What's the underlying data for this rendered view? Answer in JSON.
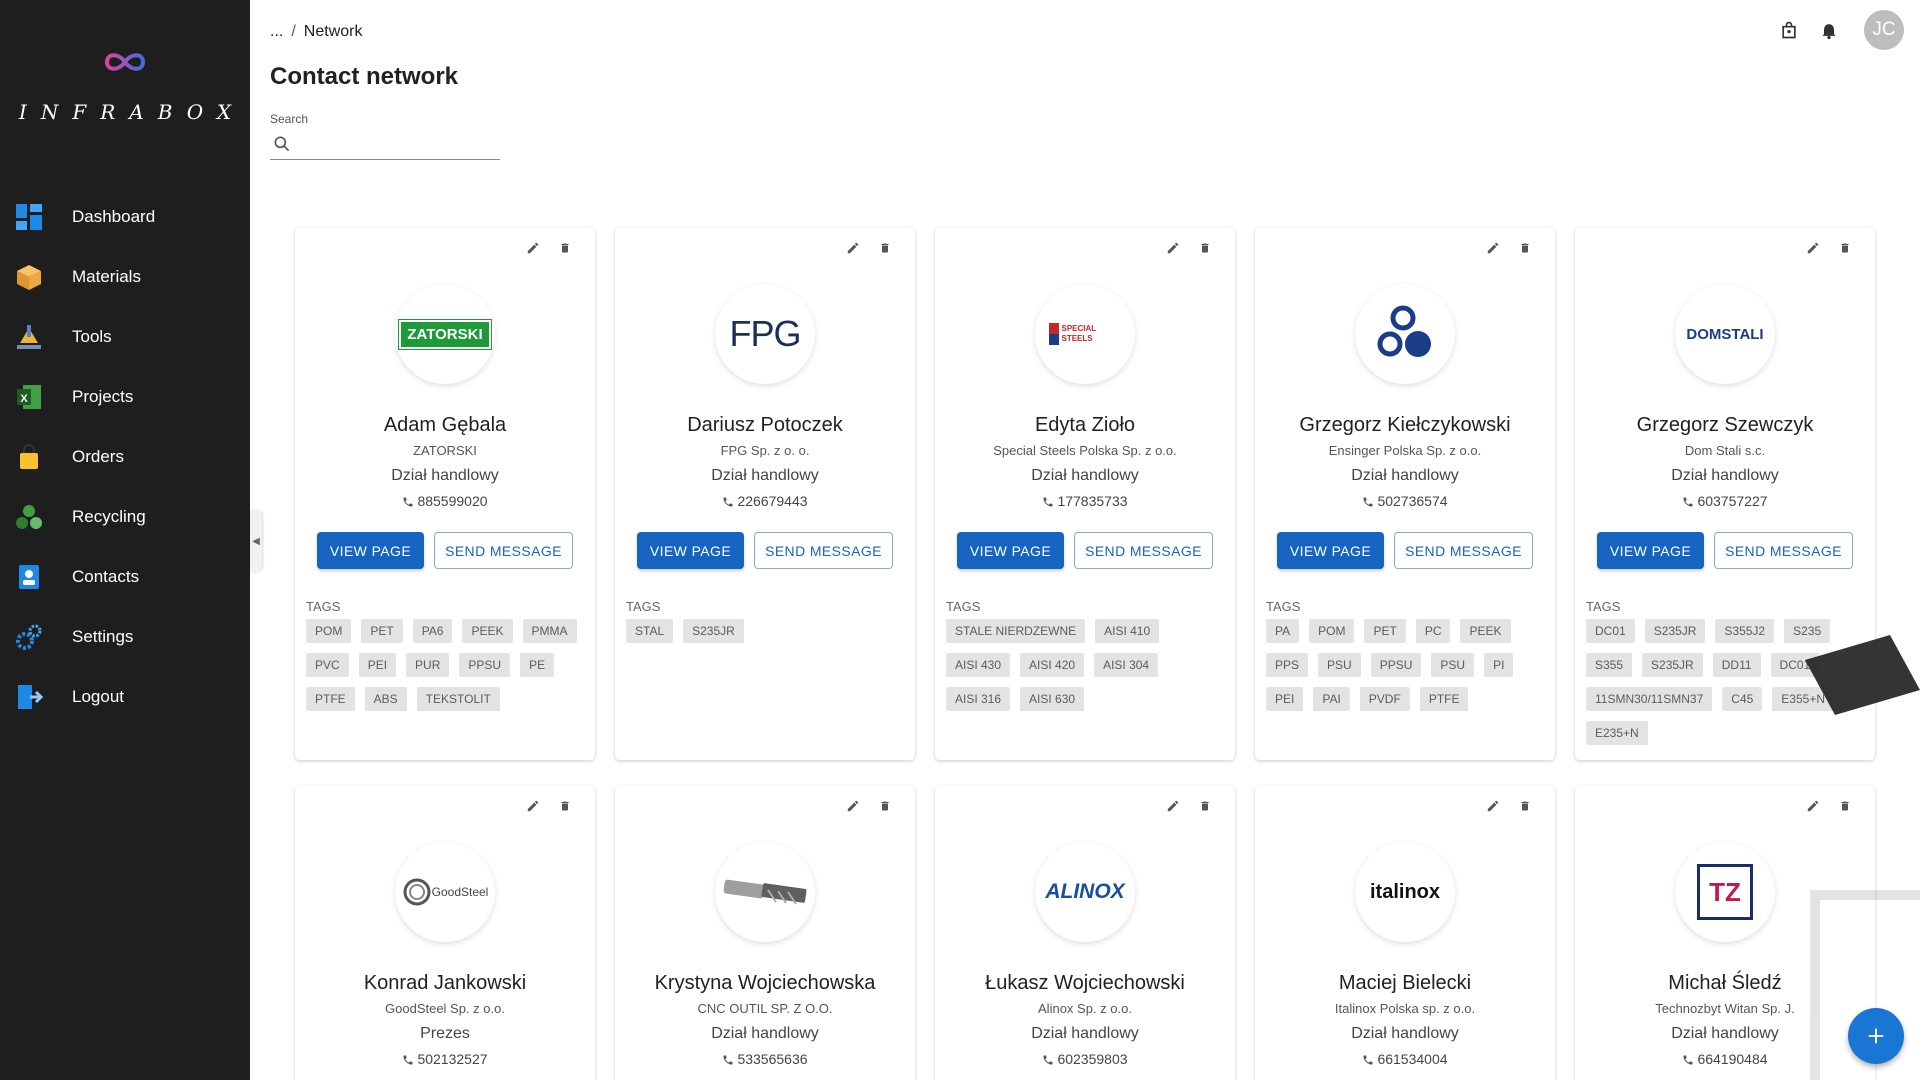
{
  "brand": {
    "name": "INFRABOX"
  },
  "nav": [
    {
      "label": "Dashboard",
      "icon": "dashboard-icon"
    },
    {
      "label": "Materials",
      "icon": "box-icon"
    },
    {
      "label": "Tools",
      "icon": "tools-icon"
    },
    {
      "label": "Projects",
      "icon": "spreadsheet-icon"
    },
    {
      "label": "Orders",
      "icon": "shopping-bag-icon"
    },
    {
      "label": "Recycling",
      "icon": "recycle-icon"
    },
    {
      "label": "Contacts",
      "icon": "contact-icon"
    },
    {
      "label": "Settings",
      "icon": "gears-icon"
    },
    {
      "label": "Logout",
      "icon": "logout-icon"
    }
  ],
  "breadcrumb": {
    "ellipsis": "...",
    "separator": "/",
    "current": "Network"
  },
  "page": {
    "title": "Contact network"
  },
  "search": {
    "label": "Search",
    "value": "",
    "placeholder": ""
  },
  "user": {
    "initials": "JC"
  },
  "labels": {
    "view": "VIEW PAGE",
    "send": "SEND MESSAGE",
    "tags": "TAGS"
  },
  "contacts": [
    {
      "name": "Adam Gębala",
      "company": "ZATORSKI",
      "department": "Dział handlowy",
      "phone": "885599020",
      "logo_text": "ZATORSKI",
      "tags": [
        "POM",
        "PET",
        "PA6",
        "PEEK",
        "PMMA",
        "PVC",
        "PEI",
        "PUR",
        "PPSU",
        "PE",
        "PTFE",
        "ABS",
        "TEKSTOLIT"
      ]
    },
    {
      "name": "Dariusz Potoczek",
      "company": "FPG Sp. z o. o.",
      "department": "Dział handlowy",
      "phone": "226679443",
      "logo_text": "FPG",
      "tags": [
        "STAL",
        "S235JR"
      ]
    },
    {
      "name": "Edyta Zioło",
      "company": "Special Steels Polska Sp. z o.o.",
      "department": "Dział handlowy",
      "phone": "177835733",
      "logo_text": "SPECIAL STEELS",
      "tags": [
        "STALE NIERDZEWNE",
        "AISI 410",
        "AISI 430",
        "AISI 420",
        "AISI 304",
        "AISI 316",
        "AISI 630"
      ]
    },
    {
      "name": "Grzegorz Kiełczykowski",
      "company": "Ensinger Polska Sp. z o.o.",
      "department": "Dział handlowy",
      "phone": "502736574",
      "logo_text": "",
      "tags": [
        "PA",
        "POM",
        "PET",
        "PC",
        "PEEK",
        "PPS",
        "PSU",
        "PPSU",
        "PSU",
        "PI",
        "PEI",
        "PAI",
        "PVDF",
        "PTFE"
      ]
    },
    {
      "name": "Grzegorz Szewczyk",
      "company": "Dom Stali s.c.",
      "department": "Dział handlowy",
      "phone": "603757227",
      "logo_text": "DOMSTALI",
      "tags": [
        "DC01",
        "S235JR",
        "S355J2",
        "S235",
        "S355",
        "S235JR",
        "DD11",
        "DC01",
        "11SMN30/11SMN37",
        "C45",
        "E355+N",
        "E235+N"
      ]
    },
    {
      "name": "Konrad Jankowski",
      "company": "GoodSteel Sp. z o.o.",
      "department": "Prezes",
      "phone": "502132527",
      "logo_text": "GoodSteel",
      "tags": []
    },
    {
      "name": "Krystyna Wojciechowska",
      "company": "CNC OUTIL SP. Z O.O.",
      "department": "Dział handlowy",
      "phone": "533565636",
      "logo_text": "",
      "tags": []
    },
    {
      "name": "Łukasz Wojciechowski",
      "company": "Alinox Sp. z o.o.",
      "department": "Dział handlowy",
      "phone": "602359803",
      "logo_text": "ALINOX",
      "tags": []
    },
    {
      "name": "Maciej Bielecki",
      "company": "Italinox Polska sp. z o.o.",
      "department": "Dział handlowy",
      "phone": "661534004",
      "logo_text": "italinox",
      "tags": []
    },
    {
      "name": "Michał Śledź",
      "company": "Technozbyt Witan Sp. J.",
      "department": "Dział handlowy",
      "phone": "664190484",
      "logo_text": "TZ",
      "tags": []
    }
  ]
}
